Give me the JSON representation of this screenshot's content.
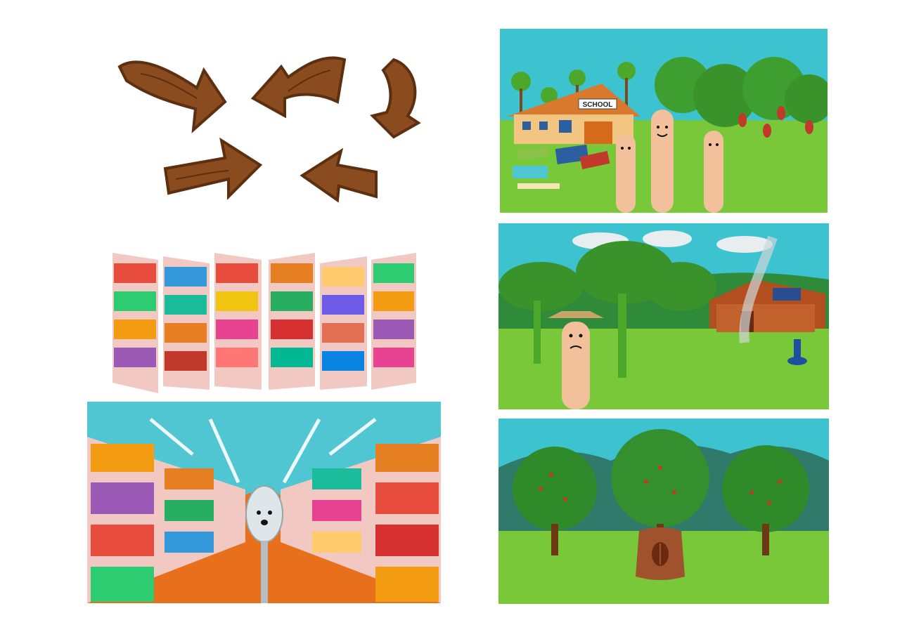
{
  "school_scene": {
    "sign_text": "SCHOOL"
  },
  "colors": {
    "wood": "#8a4b1e",
    "wood_dark": "#5c2f10",
    "sky": "#3cc3cf",
    "grass": "#79c83a",
    "shelf": "#f2c9c2",
    "aisle_floor": "#e8701c"
  },
  "icons": [
    "wooden-arrow-icon",
    "spoon-character-icon",
    "finger-character-icon",
    "coffee-sack-icon",
    "solar-panel-icon",
    "water-pump-icon"
  ]
}
